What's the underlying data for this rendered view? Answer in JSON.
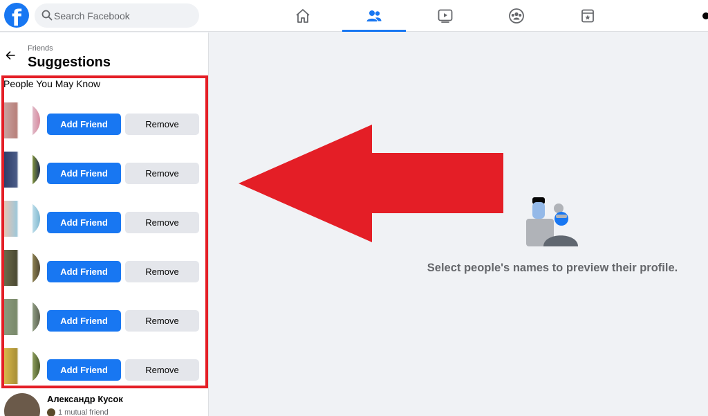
{
  "search": {
    "placeholder": "Search Facebook"
  },
  "nav": {
    "tabs": [
      {
        "name": "home",
        "active": false
      },
      {
        "name": "friends",
        "active": true
      },
      {
        "name": "watch",
        "active": false
      },
      {
        "name": "groups",
        "active": false
      },
      {
        "name": "gaming",
        "active": false
      }
    ]
  },
  "sidebar": {
    "breadcrumb": "Friends",
    "title": "Suggestions",
    "section_title": "People You May Know",
    "suggestions": [
      {
        "add_label": "Add Friend",
        "remove_label": "Remove"
      },
      {
        "add_label": "Add Friend",
        "remove_label": "Remove"
      },
      {
        "add_label": "Add Friend",
        "remove_label": "Remove"
      },
      {
        "add_label": "Add Friend",
        "remove_label": "Remove"
      },
      {
        "add_label": "Add Friend",
        "remove_label": "Remove"
      },
      {
        "add_label": "Add Friend",
        "remove_label": "Remove"
      }
    ],
    "next_person": {
      "name": "Александр Кусок",
      "mutual": "1 mutual friend"
    }
  },
  "main": {
    "empty_message": "Select people's names to preview their profile."
  },
  "colors": {
    "accent": "#1877f2",
    "annotation_red": "#e41e26"
  }
}
